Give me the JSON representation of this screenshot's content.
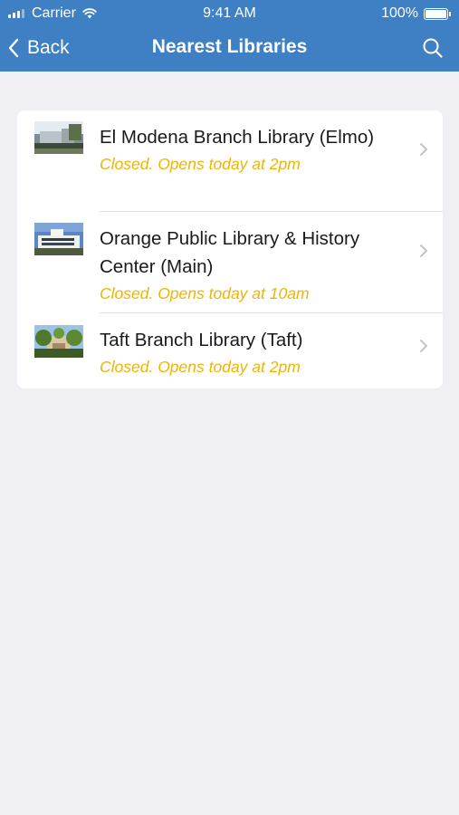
{
  "status_bar": {
    "carrier": "Carrier",
    "time": "9:41 AM",
    "battery": "100%"
  },
  "nav": {
    "back_label": "Back",
    "title": "Nearest Libraries",
    "back_icon": "chevron-left-icon",
    "search_icon": "search-icon"
  },
  "colors": {
    "header": "#3f7fc4",
    "background": "#efeff4",
    "status_text": "#f0b400"
  },
  "libraries": [
    {
      "name": "El Modena Branch Library (Elmo)",
      "status": "Closed. Opens today at 2pm"
    },
    {
      "name": "Orange Public Library & History Center (Main)",
      "status": "Closed. Opens today at 10am"
    },
    {
      "name": "Taft Branch Library (Taft)",
      "status": "Closed. Opens today at 2pm"
    }
  ]
}
